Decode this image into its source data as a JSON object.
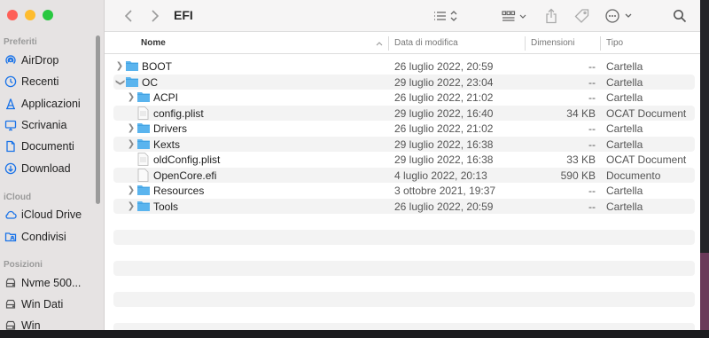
{
  "window": {
    "title": "EFI"
  },
  "sidebar": {
    "sections": [
      {
        "label": "Preferiti",
        "items": [
          {
            "label": "AirDrop",
            "icon": "airdrop-icon"
          },
          {
            "label": "Recenti",
            "icon": "clock-icon"
          },
          {
            "label": "Applicazioni",
            "icon": "applications-icon"
          },
          {
            "label": "Scrivania",
            "icon": "desktop-icon"
          },
          {
            "label": "Documenti",
            "icon": "document-icon"
          },
          {
            "label": "Download",
            "icon": "download-icon"
          }
        ]
      },
      {
        "label": "iCloud",
        "items": [
          {
            "label": "iCloud Drive",
            "icon": "cloud-icon"
          },
          {
            "label": "Condivisi",
            "icon": "shared-folder-icon"
          }
        ]
      },
      {
        "label": "Posizioni",
        "items": [
          {
            "label": "Nvme 500...",
            "icon": "disk-icon"
          },
          {
            "label": "Win Dati",
            "icon": "disk-icon"
          },
          {
            "label": "Win",
            "icon": "disk-icon"
          }
        ]
      }
    ],
    "accent_color": "#1a73e8"
  },
  "columns": {
    "name": "Nome",
    "date": "Data di modifica",
    "size": "Dimensioni",
    "kind": "Tipo"
  },
  "files": [
    {
      "name": "BOOT",
      "date": "26 luglio 2022, 20:59",
      "size": "--",
      "kind": "Cartella",
      "type": "folder",
      "depth": 0,
      "expanded": false
    },
    {
      "name": "OC",
      "date": "29 luglio 2022, 23:04",
      "size": "--",
      "kind": "Cartella",
      "type": "folder",
      "depth": 0,
      "expanded": true
    },
    {
      "name": "ACPI",
      "date": "26 luglio 2022, 21:02",
      "size": "--",
      "kind": "Cartella",
      "type": "folder",
      "depth": 1,
      "expanded": false
    },
    {
      "name": "config.plist",
      "date": "29 luglio 2022, 16:40",
      "size": "34 KB",
      "kind": "OCAT Document",
      "type": "file",
      "depth": 1
    },
    {
      "name": "Drivers",
      "date": "26 luglio 2022, 21:02",
      "size": "--",
      "kind": "Cartella",
      "type": "folder",
      "depth": 1,
      "expanded": false
    },
    {
      "name": "Kexts",
      "date": "29 luglio 2022, 16:38",
      "size": "--",
      "kind": "Cartella",
      "type": "folder",
      "depth": 1,
      "expanded": false
    },
    {
      "name": "oldConfig.plist",
      "date": "29 luglio 2022, 16:38",
      "size": "33 KB",
      "kind": "OCAT Document",
      "type": "file",
      "depth": 1
    },
    {
      "name": "OpenCore.efi",
      "date": "4 luglio 2022, 20:13",
      "size": "590 KB",
      "kind": "Documento",
      "type": "file",
      "depth": 1
    },
    {
      "name": "Resources",
      "date": "3 ottobre 2021, 19:37",
      "size": "--",
      "kind": "Cartella",
      "type": "folder",
      "depth": 1,
      "expanded": false
    },
    {
      "name": "Tools",
      "date": "26 luglio 2022, 20:59",
      "size": "--",
      "kind": "Cartella",
      "type": "folder",
      "depth": 1,
      "expanded": false
    }
  ],
  "colors": {
    "folder": "#5ab4ee",
    "close": "#fe5f57",
    "minimize": "#febc2e",
    "zoom": "#28c840"
  }
}
